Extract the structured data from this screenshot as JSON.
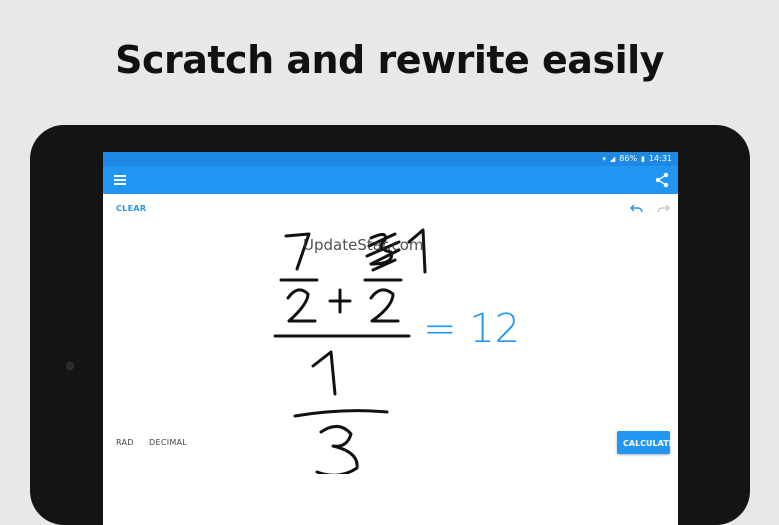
{
  "headline": "Scratch and rewrite easily",
  "status_bar": {
    "battery": "86%",
    "time": "14:31"
  },
  "toolbar": {
    "clear_label": "CLEAR"
  },
  "canvas": {
    "watermark": "UpdateStar.com",
    "result": "= 12"
  },
  "footer": {
    "rad_label": "RAD",
    "decimal_label": "DECIMAL",
    "calculate_label": "CALCULATE"
  },
  "colors": {
    "accent": "#2196f3",
    "status_bar": "#1e88e5",
    "ink": "#111111"
  },
  "icons": [
    "menu-icon",
    "share-icon",
    "undo-icon",
    "redo-icon",
    "wifi-icon",
    "signal-icon",
    "battery-icon"
  ]
}
